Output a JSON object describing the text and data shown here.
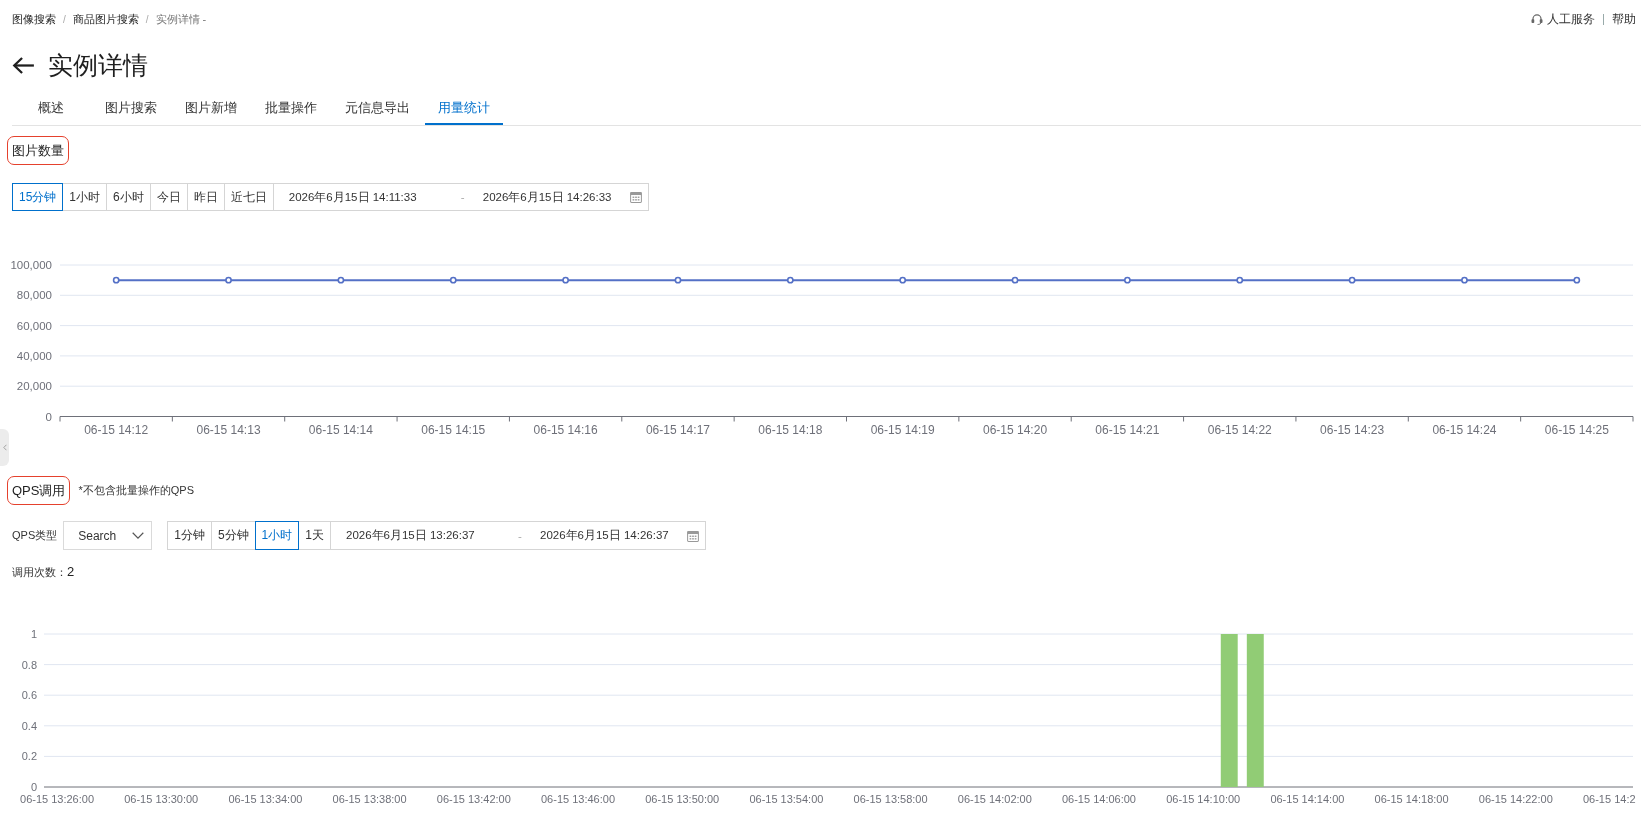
{
  "breadcrumb": {
    "separator": "/",
    "items": [
      {
        "label": "图像搜索",
        "current": false
      },
      {
        "label": "商品图片搜索",
        "current": false
      },
      {
        "label": "实例详情 -",
        "current": true
      }
    ]
  },
  "header_links": [
    {
      "kind": "support",
      "label": "人工服务"
    },
    {
      "kind": "help",
      "label": "帮助"
    }
  ],
  "page_title": "实例详情",
  "tabs": [
    {
      "label": "概述",
      "selected": false
    },
    {
      "label": "图片搜索",
      "selected": false
    },
    {
      "label": "图片新增",
      "selected": false
    },
    {
      "label": "批量操作",
      "selected": false
    },
    {
      "label": "元信息导出",
      "selected": false
    },
    {
      "label": "用量统计",
      "selected": true
    }
  ],
  "sections": [
    {
      "kind": "image_count",
      "title": "图片数量",
      "highlighted": true,
      "ranges": [
        {
          "label": "15分钟",
          "selected": true
        },
        {
          "label": "1小时",
          "selected": false
        },
        {
          "label": "6小时",
          "selected": false
        },
        {
          "label": "今日",
          "selected": false
        },
        {
          "label": "昨日",
          "selected": false
        },
        {
          "label": "近七日",
          "selected": false
        }
      ],
      "date_range": {
        "start": "2026年6月15日 14:11:33",
        "separator": "-",
        "end": "2026年6月15日 14:26:33"
      },
      "chart_data": {
        "type": "line",
        "grid": true,
        "categories": [
          "06-15 14:12",
          "06-15 14:13",
          "06-15 14:14",
          "06-15 14:15",
          "06-15 14:16",
          "06-15 14:17",
          "06-15 14:18",
          "06-15 14:19",
          "06-15 14:20",
          "06-15 14:21",
          "06-15 14:22",
          "06-15 14:23",
          "06-15 14:24",
          "06-15 14:25"
        ],
        "series": [
          {
            "color": "#5470c6",
            "marker": "circle",
            "values": [
              90000,
              90000,
              90000,
              90000,
              90000,
              90000,
              90000,
              90000,
              90000,
              90000,
              90000,
              90000,
              90000,
              90000
            ]
          }
        ],
        "ylim": [
          0,
          100000
        ],
        "yticks": [
          0,
          {
            "value": 20000,
            "label": "20,000"
          },
          {
            "value": 40000,
            "label": "40,000"
          },
          {
            "value": 60000,
            "label": "60,000"
          },
          {
            "value": 80000,
            "label": "80,000"
          },
          {
            "value": 100000,
            "label": "100,000"
          }
        ]
      }
    },
    {
      "kind": "qps",
      "title": "QPS调用",
      "highlighted": true,
      "note": "*不包含批量操作的QPS",
      "qps_type": {
        "label": "QPS类型",
        "value": "Search"
      },
      "ranges": [
        {
          "label": "1分钟",
          "selected": false
        },
        {
          "label": "5分钟",
          "selected": false
        },
        {
          "label": "1小时",
          "selected": true
        },
        {
          "label": "1天",
          "selected": false
        }
      ],
      "date_range": {
        "start": "2026年6月15日 13:26:37",
        "separator": "-",
        "end": "2026年6月15日 14:26:37"
      },
      "call_count": {
        "label": "调用次数：",
        "value": "2"
      },
      "chart_data": {
        "type": "bar",
        "grid": true,
        "categories": [
          "06-15 13:26:00",
          null,
          null,
          null,
          "06-15 13:30:00",
          null,
          null,
          null,
          "06-15 13:34:00",
          null,
          null,
          null,
          "06-15 13:38:00",
          null,
          null,
          null,
          "06-15 13:42:00",
          null,
          null,
          null,
          "06-15 13:46:00",
          null,
          null,
          null,
          "06-15 13:50:00",
          null,
          null,
          null,
          "06-15 13:54:00",
          null,
          null,
          null,
          "06-15 13:58:00",
          null,
          null,
          null,
          "06-15 14:02:00",
          null,
          null,
          null,
          "06-15 14:06:00",
          null,
          null,
          null,
          "06-15 14:10:00",
          null,
          null,
          null,
          "06-15 14:14:00",
          null,
          null,
          null,
          "06-15 14:18:00",
          null,
          null,
          null,
          "06-15 14:22:00",
          null,
          null,
          null,
          "06-15 14:2"
        ],
        "series": [
          {
            "color": "#91cc75",
            "values": [
              0,
              0,
              0,
              0,
              0,
              0,
              0,
              0,
              0,
              0,
              0,
              0,
              0,
              0,
              0,
              0,
              0,
              0,
              0,
              0,
              0,
              0,
              0,
              0,
              0,
              0,
              0,
              0,
              0,
              0,
              0,
              0,
              0,
              0,
              0,
              0,
              0,
              0,
              0,
              0,
              0,
              0,
              0,
              0,
              0,
              1,
              1,
              0,
              0,
              0,
              0,
              0,
              0,
              0,
              0,
              0,
              0,
              0,
              0,
              0,
              0
            ]
          }
        ],
        "ylim": [
          0,
          1
        ],
        "yticks": [
          0,
          0.2,
          0.4,
          0.6,
          0.8,
          1
        ]
      }
    }
  ]
}
